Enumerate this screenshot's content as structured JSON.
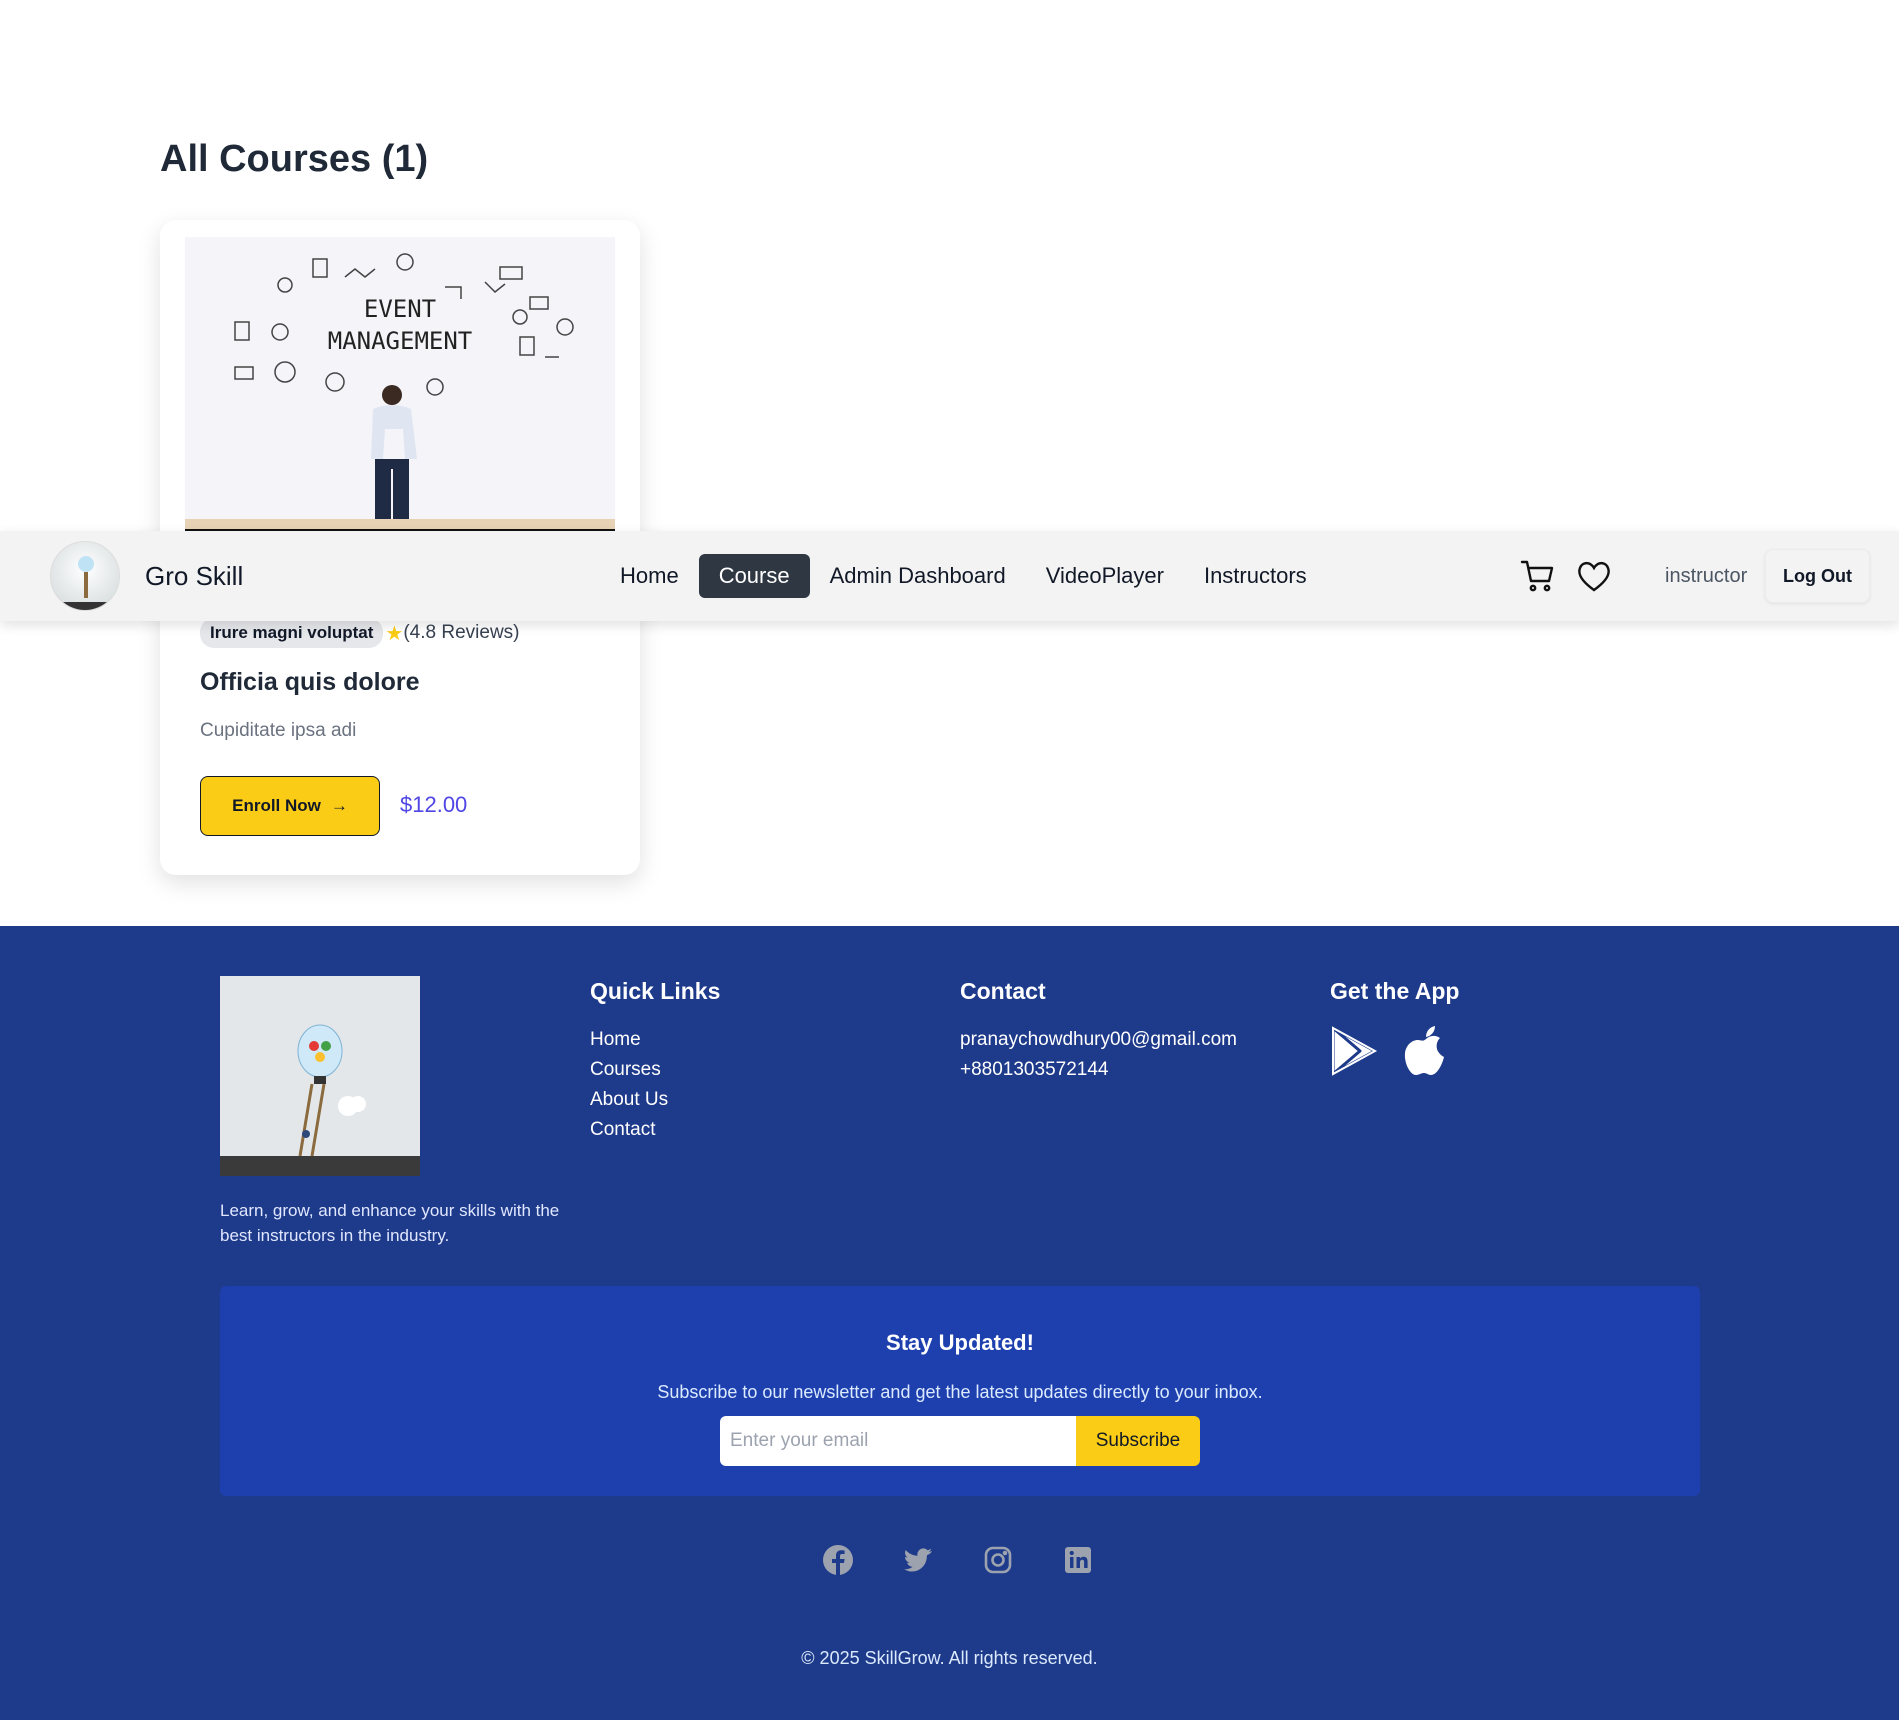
{
  "main": {
    "title": "All Courses (1)",
    "courses": [
      {
        "category": "Irure magni voluptat",
        "rating": "(4.8 Reviews)",
        "title": "Officia quis dolore",
        "description": "Cupiditate ipsa adi",
        "enroll_label": "Enroll Now",
        "price": "$12.00",
        "thumbnail_text_1": "EVENT",
        "thumbnail_text_2": "MANAGEMENT"
      }
    ]
  },
  "navbar": {
    "brand": "Gro Skill",
    "links": [
      "Home",
      "Course",
      "Admin Dashboard",
      "VideoPlayer",
      "Instructors"
    ],
    "active_link": "Course",
    "user": "instructor",
    "logout_label": "Log Out"
  },
  "footer": {
    "about": "Learn, grow, and enhance your skills with the best instructors in the industry.",
    "quick_links_title": "Quick Links",
    "quick_links": [
      "Home",
      "Courses",
      "About Us",
      "Contact"
    ],
    "contact_title": "Contact",
    "email": "pranaychowdhury00@gmail.com",
    "phone": "+8801303572144",
    "app_title": "Get the App",
    "app_icons": [
      "google-play-icon",
      "apple-icon"
    ],
    "newsletter": {
      "title": "Stay Updated!",
      "subtitle": "Subscribe to our newsletter and get the latest updates directly to your inbox.",
      "placeholder": "Enter your email",
      "button_label": "Subscribe"
    },
    "social_icons": [
      "facebook-icon",
      "twitter-icon",
      "instagram-icon",
      "linkedin-icon"
    ],
    "copyright": "© 2025 SkillGrow. All rights reserved."
  },
  "colors": {
    "accent_yellow": "#facc15",
    "footer_bg": "#1e3a8a",
    "newsletter_bg": "#1e40af",
    "price_color": "#4f46e5",
    "nav_active_bg": "#2f3742"
  }
}
